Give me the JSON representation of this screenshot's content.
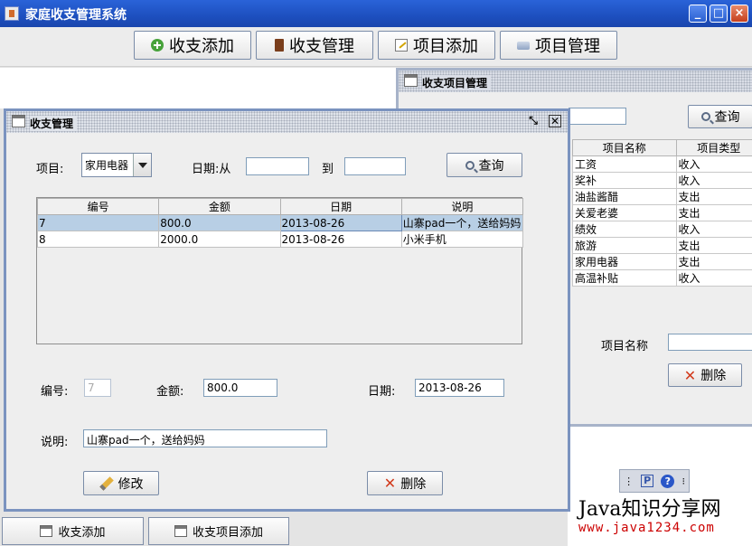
{
  "window": {
    "title": "家庭收支管理系统",
    "buttons": [
      "_",
      "□",
      "×"
    ]
  },
  "toolbar": {
    "items": [
      {
        "label": "收支添加",
        "icon": "plus-circle-icon"
      },
      {
        "label": "收支管理",
        "icon": "book-icon"
      },
      {
        "label": "项目添加",
        "icon": "edit-note-icon"
      },
      {
        "label": "项目管理",
        "icon": "drive-icon"
      }
    ]
  },
  "project_frame": {
    "title": "收支项目管理",
    "query_label": "查询",
    "columns": [
      "项目名称",
      "项目类型"
    ],
    "rows": [
      [
        "工资",
        "收入"
      ],
      [
        "奖补",
        "收入"
      ],
      [
        "油盐酱醋",
        "支出"
      ],
      [
        "关爱老婆",
        "支出"
      ],
      [
        "绩效",
        "收入"
      ],
      [
        "旅游",
        "支出"
      ],
      [
        "家用电器",
        "支出"
      ],
      [
        "高温补贴",
        "收入"
      ]
    ],
    "name_label": "项目名称",
    "delete_label": "删除"
  },
  "manage_frame": {
    "title": "收支管理",
    "project_label": "项目:",
    "project_value": "家用电器",
    "date_from_label": "日期:从",
    "date_to_label": "到",
    "date_from": "",
    "date_to": "",
    "query_label": "查询",
    "columns": [
      "编号",
      "金额",
      "日期",
      "说明"
    ],
    "rows": [
      [
        "7",
        "800.0",
        "2013-08-26",
        "山寨pad一个，送给妈妈"
      ],
      [
        "8",
        "2000.0",
        "2013-08-26",
        "小米手机"
      ]
    ],
    "id_label": "编号:",
    "id_value": "7",
    "amount_label": "金额:",
    "amount_value": "800.0",
    "date_label": "日期:",
    "date_value": "2013-08-26",
    "desc_label": "说明:",
    "desc_value": "山寨pad一个，送给妈妈",
    "edit_label": "修改",
    "delete_label": "删除"
  },
  "minimized": [
    "收支添加",
    "收支项目添加"
  ],
  "watermark": {
    "line1": "Java知识分享网",
    "line2": "www.java1234.com"
  },
  "colors": {
    "titlebar": "#2a63d8",
    "selection": "#b8cfe5",
    "delete_icon": "#d23a1c"
  }
}
